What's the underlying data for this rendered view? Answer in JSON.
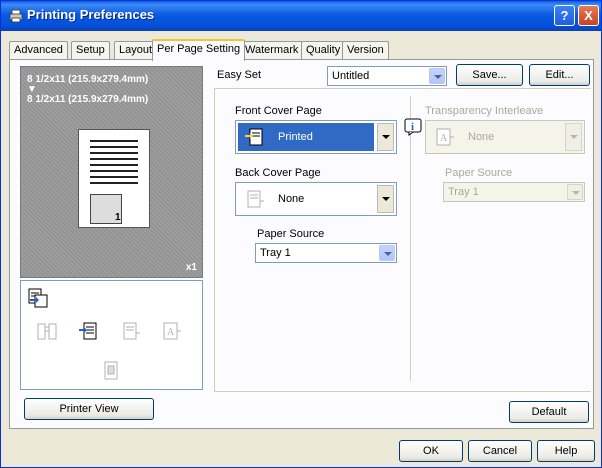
{
  "window": {
    "title": "Printing Preferences"
  },
  "titlebar": {
    "help_label": "?",
    "close_label": "X"
  },
  "tabs": [
    {
      "label": "Advanced"
    },
    {
      "label": "Setup"
    },
    {
      "label": "Layout"
    },
    {
      "label": "Per Page Setting",
      "active": true
    },
    {
      "label": "Watermark"
    },
    {
      "label": "Quality"
    },
    {
      "label": "Version"
    }
  ],
  "preview": {
    "line1": "8 1/2x11 (215.9x279.4mm)",
    "arrow": "▼",
    "line2": "8 1/2x11 (215.9x279.4mm)",
    "page_number": "1",
    "copies": "x1"
  },
  "easy_set": {
    "label": "Easy Set",
    "value": "Untitled",
    "save_label": "Save...",
    "edit_label": "Edit..."
  },
  "front_cover": {
    "label": "Front Cover Page",
    "value": "Printed"
  },
  "back_cover": {
    "label": "Back Cover Page",
    "value": "None"
  },
  "paper_source_left": {
    "label": "Paper Source",
    "value": "Tray 1"
  },
  "transparency": {
    "label": "Transparency Interleave",
    "value": "None"
  },
  "paper_source_right": {
    "label": "Paper Source",
    "value": "Tray 1"
  },
  "buttons": {
    "printer_view": "Printer View",
    "default": "Default",
    "ok": "OK",
    "cancel": "Cancel",
    "help": "Help"
  },
  "colors": {
    "titlebar": "#0a5ee8",
    "selection": "#316ac5",
    "tab_highlight": "#f4c236"
  }
}
